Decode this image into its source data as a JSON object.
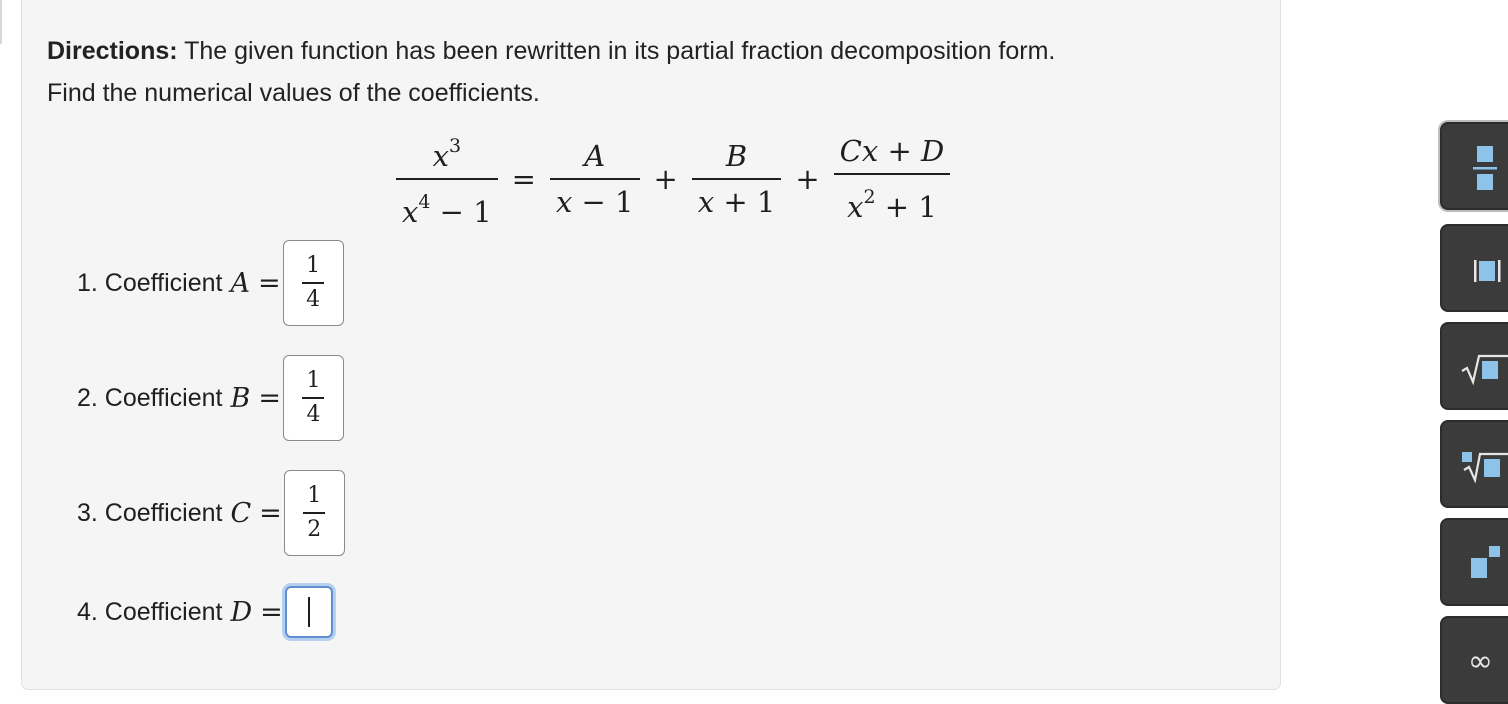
{
  "directions": {
    "label": "Directions:",
    "text": " The given function has been rewritten in its partial fraction decomposition form.",
    "text2": "Find the numerical values of the coefficients."
  },
  "equation": {
    "lhs_num_base": "x",
    "lhs_num_exp": "3",
    "lhs_den_base": "x",
    "lhs_den_exp": "4",
    "lhs_den_rest": " − 1",
    "eq": "=",
    "t1_num": "A",
    "t1_den_var": "x",
    "t1_den_rest": " − 1",
    "plus1": "+",
    "t2_num": "B",
    "t2_den_var": "x",
    "t2_den_rest": " + 1",
    "plus2": "+",
    "t3_num_c": "C",
    "t3_num_x": "x",
    "t3_num_plus": " + ",
    "t3_num_d": "D",
    "t3_den_var": "x",
    "t3_den_exp": "2",
    "t3_den_rest": " + 1"
  },
  "questions": [
    {
      "label": "1. Coefficient",
      "var": "A",
      "eq": "=",
      "num": "1",
      "den": "4"
    },
    {
      "label": "2. Coefficient",
      "var": "B",
      "eq": "=",
      "num": "1",
      "den": "4"
    },
    {
      "label": "3. Coefficient",
      "var": "C",
      "eq": "=",
      "num": "1",
      "den": "2"
    },
    {
      "label": "4. Coefficient",
      "var": "D",
      "eq": "=",
      "value": ""
    }
  ],
  "toolbar": {
    "buttons": [
      "fraction-icon",
      "absolute-value-icon",
      "square-root-icon",
      "nth-root-icon",
      "superscript-icon",
      "infinity-icon"
    ],
    "infinity_symbol": "∞"
  },
  "colors": {
    "panel_bg": "#f5f5f5",
    "toolbar_bg": "#3b3b3b",
    "toolbar_glyph": "#8ec3e9",
    "focus_ring": "#5f8fcf"
  }
}
